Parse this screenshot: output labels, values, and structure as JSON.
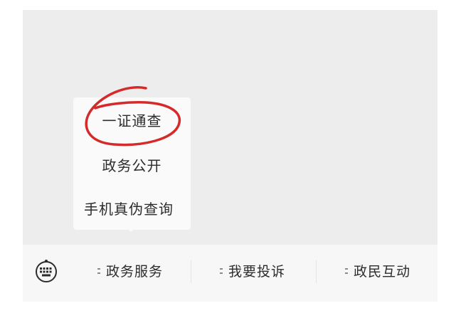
{
  "popup": {
    "items": [
      "一证通查",
      "政务公开",
      "手机真伪查询"
    ]
  },
  "bottom_menu": {
    "keyboard_icon": "keyboard-icon",
    "items": [
      "政务服务",
      "我要投诉",
      "政民互动"
    ]
  },
  "colors": {
    "chat_background": "#ededed",
    "menu_background": "#f7f7f7",
    "popup_background": "#fafafa",
    "annotation_red": "#d42a2a",
    "text": "#2c2c2c"
  }
}
